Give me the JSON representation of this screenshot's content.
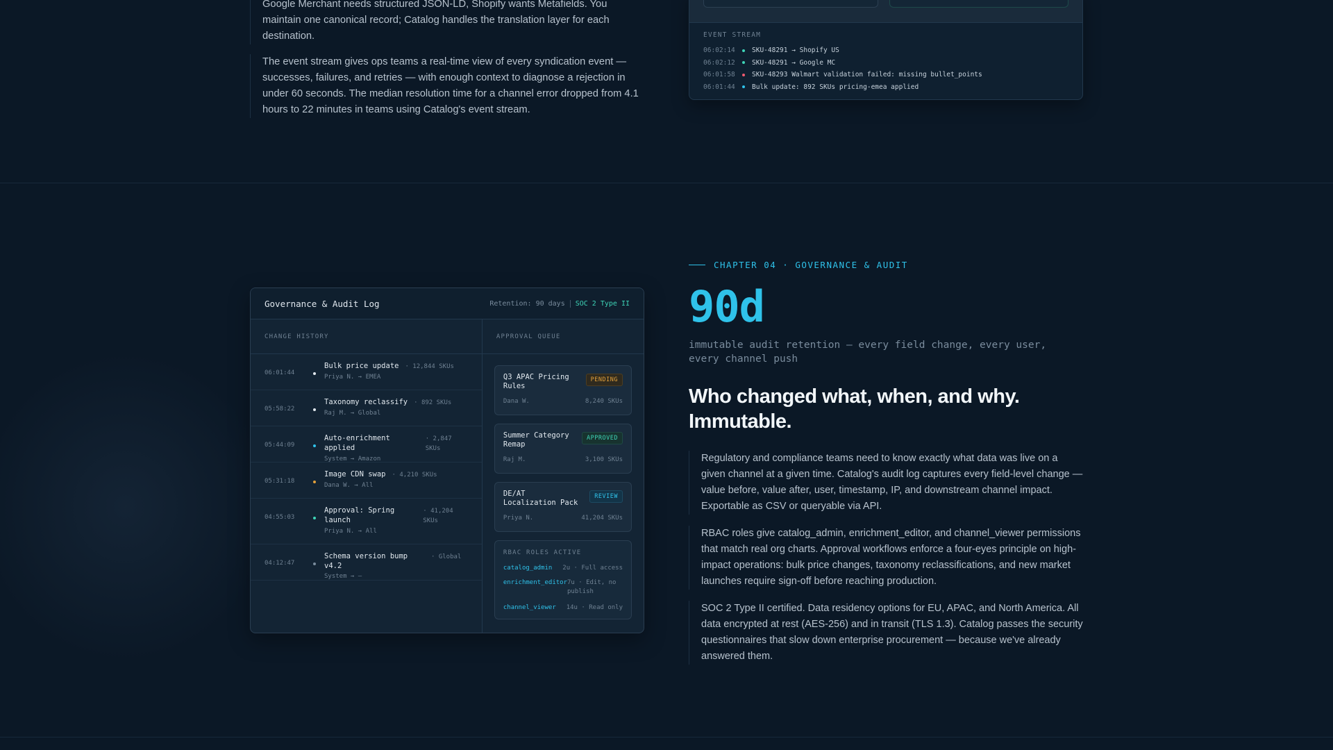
{
  "section_top": {
    "paragraphs": [
      "Google Merchant needs structured JSON-LD, Shopify wants Metafields. You maintain one canonical record; Catalog handles the translation layer for each destination.",
      "The event stream gives ops teams a real-time view of every syndication event — successes, failures, and retries — with enough context to diagnose a rejection in under 60 seconds. The median resolution time for a channel error dropped from 4.1 hours to 22 minutes in teams using Catalog's event stream."
    ],
    "event_stream": {
      "title": "EVENT STREAM",
      "events": [
        {
          "time": "06:02:14",
          "status": "success",
          "color": "#3ed4b7",
          "message": "SKU-48291 → Shopify US"
        },
        {
          "time": "06:02:12",
          "status": "success",
          "color": "#3ed4b7",
          "message": "SKU-48291 → Google MC"
        },
        {
          "time": "06:01:58",
          "status": "error",
          "color": "#ef5a6f",
          "message": "SKU-48293 Walmart validation failed: missing bullet_points"
        },
        {
          "time": "06:01:44",
          "status": "info",
          "color": "#2fc2ea",
          "message": "Bulk update: 892 SKUs pricing-emea applied"
        }
      ]
    }
  },
  "governance_panel": {
    "title": "Governance & Audit Log",
    "retention": "Retention: 90 days",
    "certification": "SOC 2 Type II",
    "change_history": {
      "heading": "CHANGE HISTORY",
      "rows": [
        {
          "time": "06:01:44",
          "color": "#e1e8ee",
          "name": "Bulk price update",
          "count": "· 12,844 SKUs",
          "meta": "Priya N. → EMEA"
        },
        {
          "time": "05:58:22",
          "color": "#e1e8ee",
          "name": "Taxonomy reclassify",
          "count": "· 892 SKUs",
          "meta": "Raj M. → Global"
        },
        {
          "time": "05:44:09",
          "color": "#2fc2ea",
          "name": "Auto-enrichment applied",
          "count": "· 2,847 SKUs",
          "meta": "System → Amazon"
        },
        {
          "time": "05:31:18",
          "color": "#e3a13b",
          "name": "Image CDN swap",
          "count": "· 4,210 SKUs",
          "meta": "Dana W. → All"
        },
        {
          "time": "04:55:03",
          "color": "#3ed4b7",
          "name": "Approval: Spring launch",
          "count": "· 41,204 SKUs",
          "meta": "Priya N. → All"
        },
        {
          "time": "04:12:47",
          "color": "#7a8c9d",
          "name": "Schema version bump v4.2",
          "count": "· Global",
          "meta": "System → —"
        }
      ]
    },
    "approval_queue": {
      "heading": "APPROVAL QUEUE",
      "items": [
        {
          "name": "Q3 APAC Pricing Rules",
          "badge": "PENDING",
          "badge_type": "pending",
          "owner": "Dana W.",
          "skus": "8,240 SKUs"
        },
        {
          "name": "Summer Category Remap",
          "badge": "APPROVED",
          "badge_type": "approved",
          "owner": "Raj M.",
          "skus": "3,100 SKUs"
        },
        {
          "name": "DE/AT Localization Pack",
          "badge": "REVIEW",
          "badge_type": "review",
          "owner": "Priya N.",
          "skus": "41,204 SKUs"
        }
      ],
      "rbac": {
        "title": "RBAC ROLES ACTIVE",
        "roles": [
          {
            "role": "catalog_admin",
            "desc": "2u · Full access"
          },
          {
            "role": "enrichment_editor",
            "desc": "7u · Edit, no publish"
          },
          {
            "role": "channel_viewer",
            "desc": "14u · Read only"
          }
        ]
      }
    }
  },
  "chapter": {
    "label": "CHAPTER 04 · GOVERNANCE & AUDIT",
    "stat": "90d",
    "stat_caption": "immutable audit retention — every field change, every user, every channel push",
    "headline": "Who changed what, when, and why. Immutable.",
    "paragraphs": [
      "Regulatory and compliance teams need to know exactly what data was live on a given channel at a given time. Catalog's audit log captures every field-level change — value before, value after, user, timestamp, IP, and downstream channel impact. Exportable as CSV or queryable via API.",
      "RBAC roles give catalog_admin, enrichment_editor, and channel_viewer permissions that match real org charts. Approval workflows enforce a four-eyes principle on high-impact operations: bulk price changes, taxonomy reclassifications, and new market launches require sign-off before reaching production.",
      "SOC 2 Type II certified. Data residency options for EU, APAC, and North America. All data encrypted at rest (AES-256) and in transit (TLS 1.3). Catalog passes the security questionnaires that slow down enterprise procurement — because we've already answered them."
    ]
  }
}
